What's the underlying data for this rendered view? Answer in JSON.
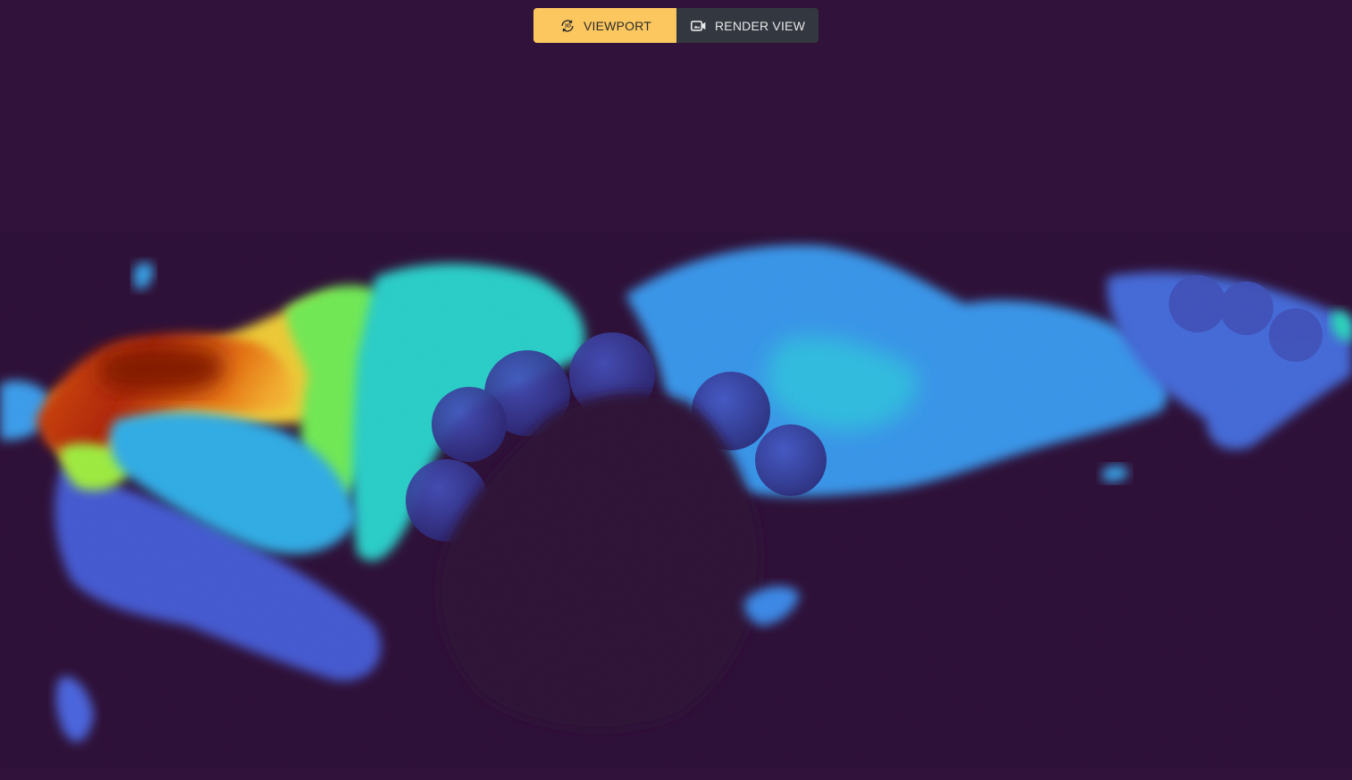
{
  "viewer": {
    "background_color": "#31123b",
    "colormap": "turbo"
  },
  "view_toggle": {
    "active": "viewport",
    "viewport": {
      "label": "VIEWPORT",
      "icon": "3d-rotate-icon",
      "background_color": "#fcc75e"
    },
    "render_view": {
      "label": "RENDER VIEW",
      "icon": "video-camera-icon",
      "background_color": "#33373f"
    }
  }
}
